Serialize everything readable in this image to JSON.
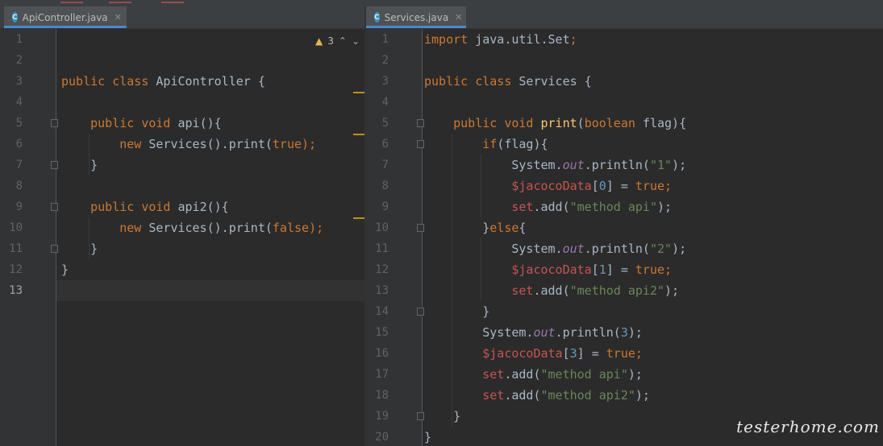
{
  "tabs": {
    "left": {
      "label": "ApiController.java",
      "icon": "class-icon",
      "icon_letter": "C"
    },
    "right": {
      "label": "Services.java",
      "icon": "class-icon",
      "icon_letter": "C"
    }
  },
  "left_editor": {
    "warnings_count": "3",
    "current_line": 13,
    "lines": [
      {
        "n": "1",
        "tokens": []
      },
      {
        "n": "2",
        "tokens": []
      },
      {
        "n": "3",
        "tokens": [
          {
            "t": "public class ",
            "c": "kw"
          },
          {
            "t": "ApiController ",
            "c": "pl"
          },
          {
            "t": "{",
            "c": "pl"
          }
        ]
      },
      {
        "n": "4",
        "tokens": []
      },
      {
        "n": "5",
        "tokens": [
          {
            "t": "    ",
            "c": "pl"
          },
          {
            "t": "public void ",
            "c": "kw"
          },
          {
            "t": "api",
            "c": "pl"
          },
          {
            "t": "(){",
            "c": "pl"
          }
        ]
      },
      {
        "n": "6",
        "tokens": [
          {
            "t": "        ",
            "c": "pl"
          },
          {
            "t": "new ",
            "c": "kw"
          },
          {
            "t": "Services().print(",
            "c": "pl"
          },
          {
            "t": "true",
            "c": "kw"
          },
          {
            "t": ");",
            "c": "kw"
          }
        ]
      },
      {
        "n": "7",
        "tokens": [
          {
            "t": "    }",
            "c": "pl"
          }
        ]
      },
      {
        "n": "8",
        "tokens": []
      },
      {
        "n": "9",
        "tokens": [
          {
            "t": "    ",
            "c": "pl"
          },
          {
            "t": "public void ",
            "c": "kw"
          },
          {
            "t": "api2",
            "c": "pl"
          },
          {
            "t": "(){",
            "c": "pl"
          }
        ]
      },
      {
        "n": "10",
        "tokens": [
          {
            "t": "        ",
            "c": "pl"
          },
          {
            "t": "new ",
            "c": "kw"
          },
          {
            "t": "Services().print(",
            "c": "pl"
          },
          {
            "t": "false",
            "c": "kw"
          },
          {
            "t": ");",
            "c": "kw"
          }
        ]
      },
      {
        "n": "11",
        "tokens": [
          {
            "t": "    }",
            "c": "pl"
          }
        ]
      },
      {
        "n": "12",
        "tokens": [
          {
            "t": "}",
            "c": "pl"
          }
        ]
      },
      {
        "n": "13",
        "tokens": []
      }
    ]
  },
  "right_editor": {
    "lines": [
      {
        "n": "1",
        "tokens": [
          {
            "t": "import ",
            "c": "kw"
          },
          {
            "t": "java.util.Set",
            "c": "pl"
          },
          {
            "t": ";",
            "c": "kw"
          }
        ]
      },
      {
        "n": "2",
        "tokens": []
      },
      {
        "n": "3",
        "tokens": [
          {
            "t": "public class ",
            "c": "kw"
          },
          {
            "t": "Services ",
            "c": "pl"
          },
          {
            "t": "{",
            "c": "pl"
          }
        ]
      },
      {
        "n": "4",
        "tokens": []
      },
      {
        "n": "5",
        "tokens": [
          {
            "t": "    ",
            "c": "pl"
          },
          {
            "t": "public void ",
            "c": "kw"
          },
          {
            "t": "print",
            "c": "fn"
          },
          {
            "t": "(",
            "c": "pl"
          },
          {
            "t": "boolean ",
            "c": "kw"
          },
          {
            "t": "flag){",
            "c": "pl"
          }
        ]
      },
      {
        "n": "6",
        "tokens": [
          {
            "t": "        ",
            "c": "pl"
          },
          {
            "t": "if",
            "c": "kw"
          },
          {
            "t": "(flag){",
            "c": "pl"
          }
        ]
      },
      {
        "n": "7",
        "tokens": [
          {
            "t": "            System.",
            "c": "pl"
          },
          {
            "t": "out",
            "c": "fd"
          },
          {
            "t": ".println(",
            "c": "pl"
          },
          {
            "t": "\"1\"",
            "c": "st"
          },
          {
            "t": ");",
            "c": "pl"
          }
        ]
      },
      {
        "n": "8",
        "tokens": [
          {
            "t": "            ",
            "c": "pl"
          },
          {
            "t": "$jacocoData",
            "c": "lv"
          },
          {
            "t": "[",
            "c": "pl"
          },
          {
            "t": "0",
            "c": "nm"
          },
          {
            "t": "] = ",
            "c": "pl"
          },
          {
            "t": "true",
            "c": "kw"
          },
          {
            "t": ";",
            "c": "kw"
          }
        ]
      },
      {
        "n": "9",
        "tokens": [
          {
            "t": "            ",
            "c": "pl"
          },
          {
            "t": "set",
            "c": "lv"
          },
          {
            "t": ".add(",
            "c": "pl"
          },
          {
            "t": "\"method api\"",
            "c": "st"
          },
          {
            "t": ");",
            "c": "pl"
          }
        ]
      },
      {
        "n": "10",
        "tokens": [
          {
            "t": "        }",
            "c": "pl"
          },
          {
            "t": "else",
            "c": "kw"
          },
          {
            "t": "{",
            "c": "pl"
          }
        ]
      },
      {
        "n": "11",
        "tokens": [
          {
            "t": "            System.",
            "c": "pl"
          },
          {
            "t": "out",
            "c": "fd"
          },
          {
            "t": ".println(",
            "c": "pl"
          },
          {
            "t": "\"2\"",
            "c": "st"
          },
          {
            "t": ");",
            "c": "pl"
          }
        ]
      },
      {
        "n": "12",
        "tokens": [
          {
            "t": "            ",
            "c": "pl"
          },
          {
            "t": "$jacocoData",
            "c": "lv"
          },
          {
            "t": "[",
            "c": "pl"
          },
          {
            "t": "1",
            "c": "nm"
          },
          {
            "t": "] = ",
            "c": "pl"
          },
          {
            "t": "true",
            "c": "kw"
          },
          {
            "t": ";",
            "c": "kw"
          }
        ]
      },
      {
        "n": "13",
        "tokens": [
          {
            "t": "            ",
            "c": "pl"
          },
          {
            "t": "set",
            "c": "lv"
          },
          {
            "t": ".add(",
            "c": "pl"
          },
          {
            "t": "\"method api2\"",
            "c": "st"
          },
          {
            "t": ");",
            "c": "pl"
          }
        ]
      },
      {
        "n": "14",
        "tokens": [
          {
            "t": "        }",
            "c": "pl"
          }
        ]
      },
      {
        "n": "15",
        "tokens": [
          {
            "t": "        System.",
            "c": "pl"
          },
          {
            "t": "out",
            "c": "fd"
          },
          {
            "t": ".println(",
            "c": "pl"
          },
          {
            "t": "3",
            "c": "nm"
          },
          {
            "t": ");",
            "c": "pl"
          }
        ]
      },
      {
        "n": "16",
        "tokens": [
          {
            "t": "        ",
            "c": "pl"
          },
          {
            "t": "$jacocoData",
            "c": "lv"
          },
          {
            "t": "[",
            "c": "pl"
          },
          {
            "t": "3",
            "c": "nm"
          },
          {
            "t": "] = ",
            "c": "pl"
          },
          {
            "t": "true",
            "c": "kw"
          },
          {
            "t": ";",
            "c": "kw"
          }
        ]
      },
      {
        "n": "17",
        "tokens": [
          {
            "t": "        ",
            "c": "pl"
          },
          {
            "t": "set",
            "c": "lv"
          },
          {
            "t": ".add(",
            "c": "pl"
          },
          {
            "t": "\"method api\"",
            "c": "st"
          },
          {
            "t": ");",
            "c": "pl"
          }
        ]
      },
      {
        "n": "18",
        "tokens": [
          {
            "t": "        ",
            "c": "pl"
          },
          {
            "t": "set",
            "c": "lv"
          },
          {
            "t": ".add(",
            "c": "pl"
          },
          {
            "t": "\"method api2\"",
            "c": "st"
          },
          {
            "t": ");",
            "c": "pl"
          }
        ]
      },
      {
        "n": "19",
        "tokens": [
          {
            "t": "    }",
            "c": "pl"
          }
        ]
      },
      {
        "n": "20",
        "tokens": [
          {
            "t": "}",
            "c": "pl"
          }
        ]
      }
    ]
  },
  "watermark": "testerhome.com",
  "colors": {
    "keyword": "#cc7832",
    "method": "#ffc66d",
    "string": "#6a8759",
    "number": "#6897bb",
    "field": "#9876aa",
    "local_var": "#c75450",
    "plain": "#a9b7c6"
  }
}
